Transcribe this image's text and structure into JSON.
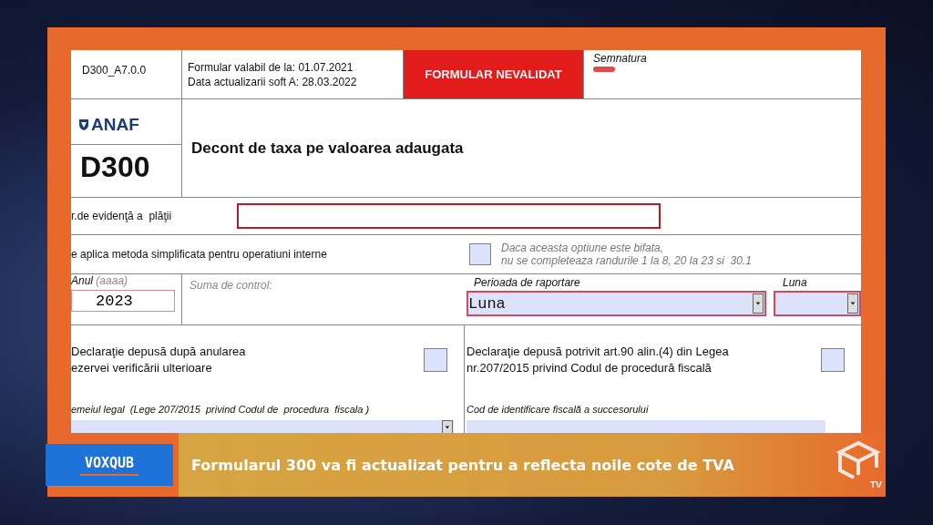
{
  "form": {
    "version": "D300_A7.0.0",
    "valid_from": "Formular valabil de la: 01.07.2021",
    "soft_date": "Data actualizarii soft A: 28.03.2022",
    "status": "FORMULAR NEVALIDAT",
    "signature_label": "Semnatura",
    "agency": "ANAF",
    "code": "D300",
    "title": "Decont de taxa pe valoarea adaugata",
    "payment_label": "r.de evidenţă a  plăţii",
    "simplified": {
      "label": "e aplica metoda simplificata pentru operatiuni interne",
      "checked": false,
      "hint_lines": [
        "Daca aceasta optiune este bifata,",
        "nu se completeaza randurile 1 la 8, 20 la 23 si  30.1"
      ]
    },
    "year": {
      "label": "Anul",
      "hint": "(aaaa)",
      "value": "2023"
    },
    "control_sum_label": "Suma de control:",
    "period": {
      "label": "Perioada de raportare",
      "value": "Luna"
    },
    "month": {
      "label": "Luna"
    },
    "declarations": [
      {
        "lines": [
          "Declaraţie depusă după anularea",
          "ezervei verificării ulterioare"
        ],
        "checked": false
      },
      {
        "lines": [
          "Declaraţie depusă potrivit art.90 alin.(4) din Legea",
          "nr.207/2015 privind Codul de procedură fiscală"
        ],
        "checked": false
      }
    ],
    "legal_basis_label": "emeiul legal  (Lege 207/2015  privind Codul de  procedura  fiscala )",
    "successor_label": "Cod de identificare fiscală a succesorului"
  },
  "lower_third": {
    "channel": "VOXQUB",
    "headline": "Formularul 300 va fi actualizat pentru a reflecta noile cote de TVA",
    "logo_badge": "TV"
  }
}
